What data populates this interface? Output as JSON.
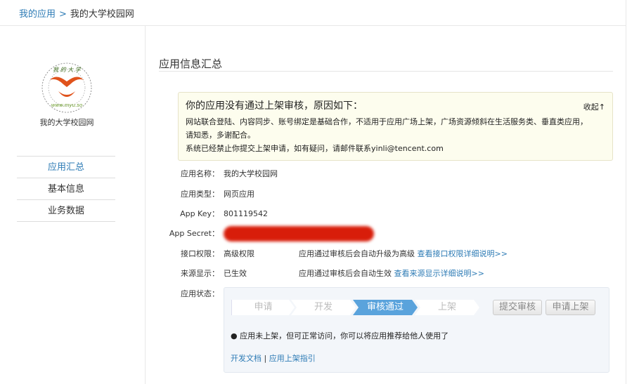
{
  "breadcrumb": {
    "parent": "我的应用",
    "separator": ">",
    "current": "我的大学校园网"
  },
  "sidebar": {
    "app_name": "我的大学校园网",
    "logo_text": "我的大学 www.myu.so",
    "items": [
      {
        "label": "应用汇总",
        "active": true
      },
      {
        "label": "基本信息"
      },
      {
        "label": "业务数据"
      }
    ]
  },
  "main": {
    "title": "应用信息汇总",
    "notice": {
      "heading": "你的应用没有通过上架审核，原因如下：",
      "collapse": "收起↑",
      "line1": "网站联合登陆、内容同步、账号绑定是基础合作，不适用于应用广场上架，广场资源倾斜在生活服务类、垂直类应用，",
      "line2": "请知悉，多谢配合。",
      "line3": "系统已经禁止你提交上架申请，如有疑问，请邮件联系yinli@tencent.com"
    },
    "fields": [
      {
        "label": "应用名称：",
        "value": "我的大学校园网"
      },
      {
        "label": "应用类型：",
        "value": "网页应用"
      },
      {
        "label": "App Key：",
        "value": "801119542"
      },
      {
        "label": "App Secret：",
        "value": ""
      },
      {
        "label": "接口权限：",
        "value": "高级权限",
        "note": "应用通过审核后会自动升级为高级",
        "link": "查看接口权限详细说明>>"
      },
      {
        "label": "来源显示：",
        "value": "已生效",
        "note": "应用通过审核后会自动生效",
        "link": "查看来源显示详细说明>>"
      }
    ],
    "status": {
      "label": "应用状态：",
      "steps": [
        "申请",
        "开发",
        "审核通过",
        "上架"
      ],
      "current_step": 2,
      "buttons": [
        "提交审核",
        "申请上架"
      ],
      "message": "应用未上架，但可正常访问，你可以将应用推荐给他人使用了",
      "links": [
        "开发文档",
        "应用上架指引"
      ],
      "link_sep": "|"
    }
  },
  "colors": {
    "link": "#2d7bb5",
    "active_step": "#5aa3dc",
    "notice_bg": "#fdfdee"
  }
}
